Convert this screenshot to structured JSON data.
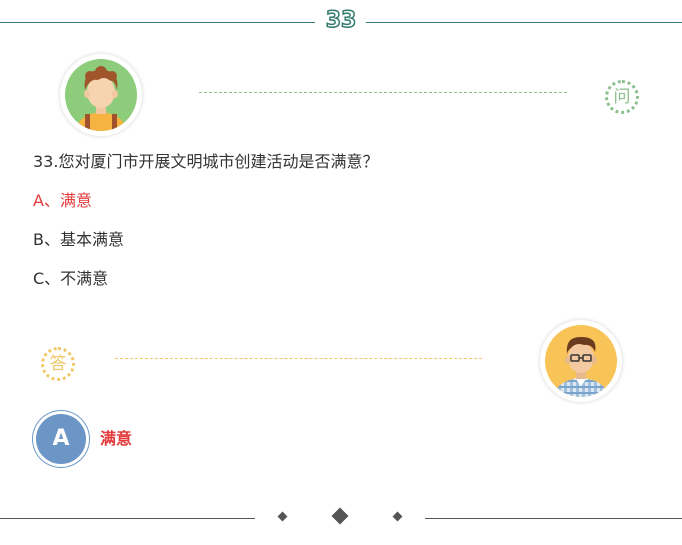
{
  "header": {
    "question_number": "33"
  },
  "question": {
    "ask_badge": "问",
    "text": "33.您对厦门市开展文明城市创建活动是否满意？",
    "options": [
      {
        "label": "A、满意",
        "selected": true
      },
      {
        "label": "B、基本满意",
        "selected": false
      },
      {
        "label": "C、不满意",
        "selected": false
      }
    ]
  },
  "answer": {
    "answer_badge": "答",
    "letter": "A",
    "text": "满意"
  },
  "colors": {
    "accent_red": "#e23b3b",
    "header_green": "#2f7a6c",
    "ask_green": "#8cc08c",
    "answer_yellow": "#f0c86a",
    "answer_blue": "#6b96c6"
  }
}
